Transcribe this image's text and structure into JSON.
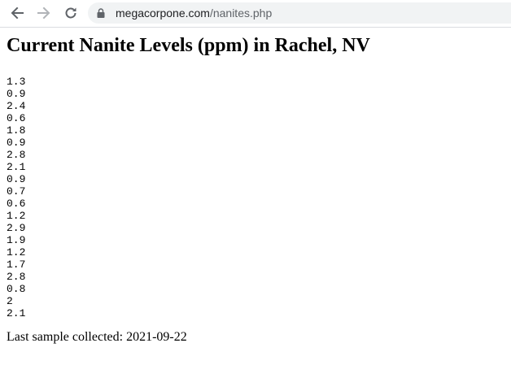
{
  "browser": {
    "url_host": "megacorpone.com",
    "url_path": "/nanites.php"
  },
  "page": {
    "title": "Current Nanite Levels (ppm) in Rachel, NV",
    "readings": [
      "1.3",
      "0.9",
      "2.4",
      "0.6",
      "1.8",
      "0.9",
      "2.8",
      "2.1",
      "0.9",
      "0.7",
      "0.6",
      "1.2",
      "2.9",
      "1.9",
      "1.2",
      "1.7",
      "2.8",
      "0.8",
      "2",
      "2.1"
    ],
    "last_sample_label": "Last sample collected: ",
    "last_sample_date": "2021-09-22"
  },
  "icons": {
    "back": "arrow-left-icon",
    "forward": "arrow-right-icon",
    "reload": "reload-icon",
    "lock": "lock-icon"
  }
}
